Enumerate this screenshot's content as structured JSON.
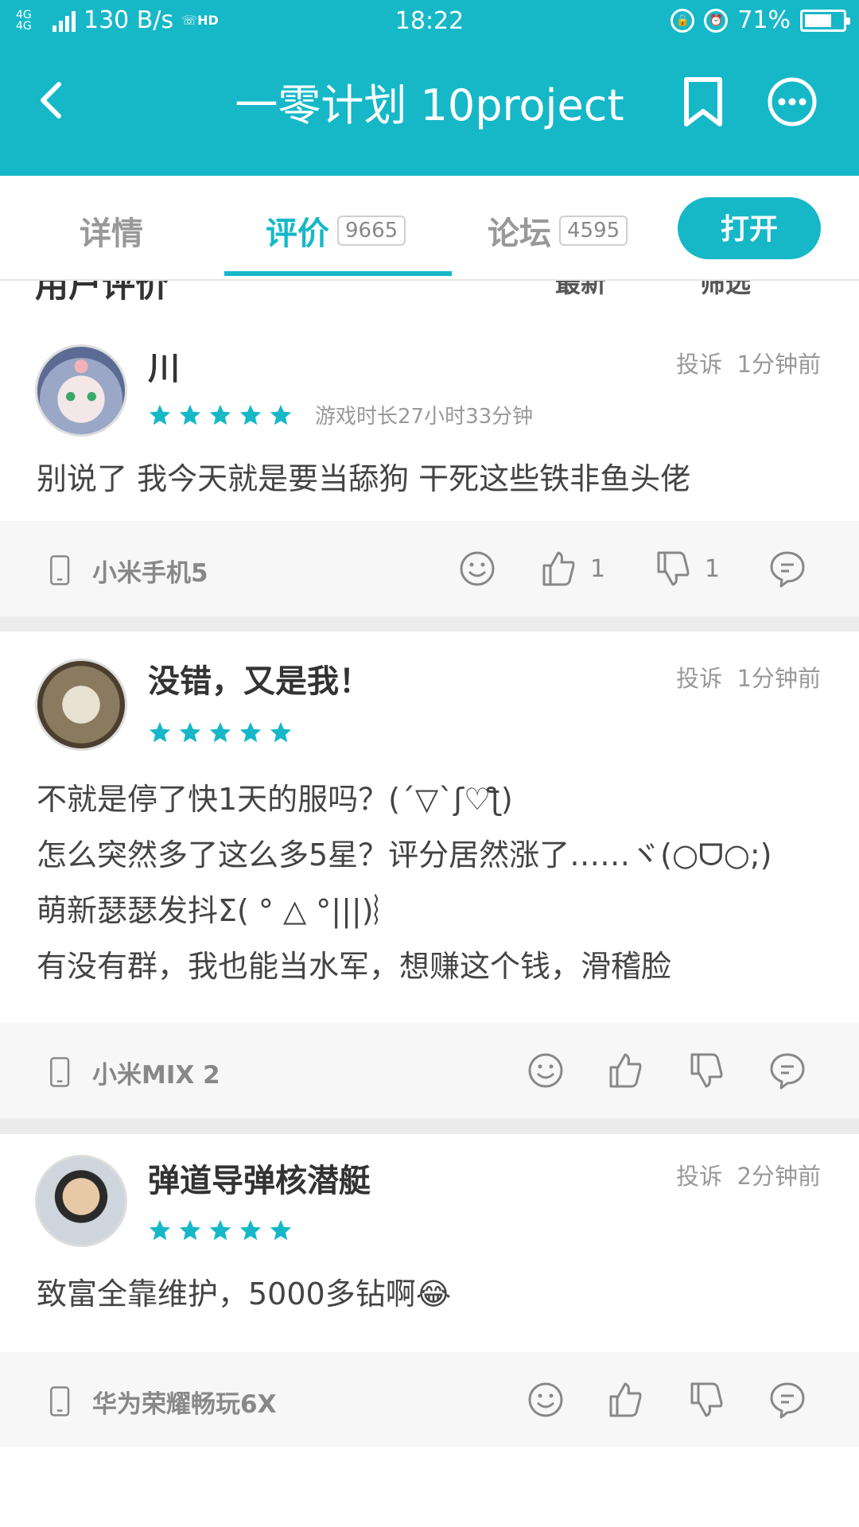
{
  "status_bar": {
    "network": "4G 4G",
    "speed": "130 B/s",
    "hd": "HD",
    "time": "18:22",
    "battery": "71%",
    "battery_level": 0.71
  },
  "nav": {
    "title": "一零计划 10project",
    "back_icon": "back-arrow-icon",
    "bookmark_icon": "bookmark-icon",
    "more_icon": "more-icon"
  },
  "tabs": [
    {
      "label": "详情"
    },
    {
      "label": "评价",
      "count": "9665",
      "active": true
    },
    {
      "label": "论坛",
      "count": "4595"
    }
  ],
  "open_button": "打开",
  "section_peek": {
    "title": "用户评价",
    "sort1": "最新",
    "sort2": "筛选"
  },
  "reviews": [
    {
      "user": "川",
      "report": "投诉",
      "time": "1分钟前",
      "rating": 5,
      "playtime": "游戏时长27小时33分钟",
      "lines": [
        "别说了 我今天就是要当舔狗 干死这些铁非鱼头佬"
      ],
      "device": "小米手机5",
      "likes": "1",
      "dislikes": "1"
    },
    {
      "user": "没错，又是我！",
      "report": "投诉",
      "time": "1分钟前",
      "rating": 5,
      "lines": [
        "不就是停了快1天的服吗？(´▽`ʃ♡ƪ)",
        "怎么突然多了这么多5星？评分居然涨了……ヾ(○ᗜ○;)",
        "萌新瑟瑟发抖Σ( ° △ °|||)︴",
        "有没有群，我也能当水军，想赚这个钱，滑稽脸"
      ],
      "device": "小米MIX 2"
    },
    {
      "user": "弹道导弹核潜艇",
      "report": "投诉",
      "time": "2分钟前",
      "rating": 5,
      "lines": [
        "致富全靠维护，5000多钻啊😂"
      ],
      "device": "华为荣耀畅玩6X"
    }
  ],
  "colors": {
    "accent": "#16b8c8",
    "footer_bg": "#f7f7f7",
    "divider": "#ececec"
  }
}
